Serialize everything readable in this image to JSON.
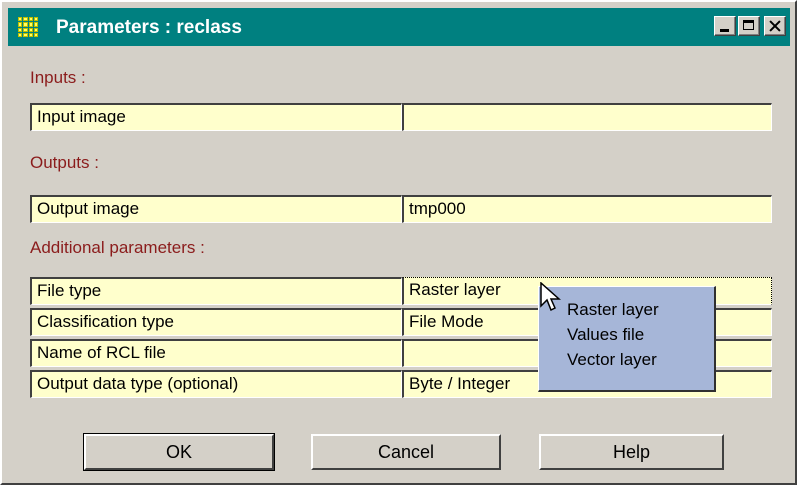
{
  "window": {
    "title": "Parameters : reclass",
    "icon": "grid-app-icon",
    "controls": [
      "minimize-icon",
      "maximize-icon",
      "close-icon"
    ]
  },
  "sections": {
    "inputs": "Inputs :",
    "outputs": "Outputs :",
    "additional": "Additional parameters :"
  },
  "inputs": [
    {
      "label": "Input image",
      "value": ""
    }
  ],
  "outputs": [
    {
      "label": "Output image",
      "value": "tmp000"
    }
  ],
  "additional": [
    {
      "label": "File type",
      "value": "Raster layer"
    },
    {
      "label": "Classification type",
      "value": "File Mode"
    },
    {
      "label": "Name of RCL file",
      "value": ""
    },
    {
      "label": "Output data type (optional)",
      "value": "Byte / Integer"
    }
  ],
  "dropdown": {
    "options": [
      "Raster layer",
      "Values file",
      "Vector layer"
    ]
  },
  "buttons": {
    "ok": "OK",
    "cancel": "Cancel",
    "help": "Help"
  },
  "colors": {
    "titlebar": "#008080",
    "section_label": "#8b1c1c",
    "cell_background": "#ffffcc",
    "dropdown_background": "#a6b6d8"
  }
}
